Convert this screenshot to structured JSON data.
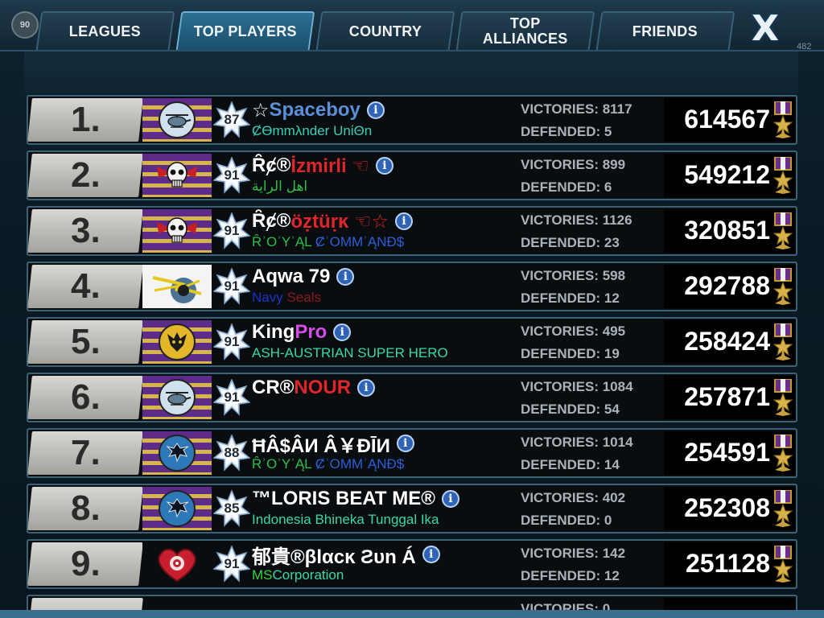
{
  "top_bar": {
    "level_badge": "90",
    "tabs": [
      {
        "label": "LEAGUES",
        "active": false
      },
      {
        "label": "TOP PLAYERS",
        "active": true
      },
      {
        "label": "COUNTRY",
        "active": false
      },
      {
        "label": "TOP\nALLIANCES",
        "active": false
      },
      {
        "label": "FRIENDS",
        "active": false
      }
    ],
    "close_label": "X",
    "corner_text": "482"
  },
  "stat_labels": {
    "victories": "VICTORIES:",
    "defended": "DEFENDED:"
  },
  "players": [
    {
      "rank": "1.",
      "level": "87",
      "emblem": "helicopter-emblem",
      "name_parts": [
        {
          "text": "☆",
          "color": "#ffffff"
        },
        {
          "text": "Spaceboy",
          "color": "#5b8fd8"
        }
      ],
      "alliance_parts": [
        {
          "text": "ȻӨmmλnder UnίΘn",
          "color": "#37d0b6"
        }
      ],
      "victories": "8117",
      "defended": "5",
      "score": "614567"
    },
    {
      "rank": "2.",
      "level": "91",
      "emblem": "skull-emblem",
      "name_parts": [
        {
          "text": "Ȓȼ®",
          "color": "#ffffff"
        },
        {
          "text": "İzmirli ☜",
          "color": "#e0252b"
        }
      ],
      "alliance_parts": [
        {
          "text": "اهل الراية",
          "color": "#2bbf4a"
        }
      ],
      "victories": "899",
      "defended": "6",
      "score": "549212"
    },
    {
      "rank": "3.",
      "level": "91",
      "emblem": "skull-emblem",
      "name_parts": [
        {
          "text": "Ȓȼ®",
          "color": "#ffffff"
        },
        {
          "text": "öẓtüṛĸ ☜☆",
          "color": "#e0252b"
        }
      ],
      "alliance_parts": [
        {
          "text": "ȒʾOʾYʾĄL ",
          "color": "#2bbf4a"
        },
        {
          "text": "ȻʾOMMʾĄNĐ$",
          "color": "#2a5fd6"
        }
      ],
      "victories": "1126",
      "defended": "23",
      "score": "320851"
    },
    {
      "rank": "4.",
      "level": "91",
      "emblem": "lightning-emblem",
      "name_parts": [
        {
          "text": "Aqwa 79",
          "color": "#ffffff"
        }
      ],
      "alliance_parts": [
        {
          "text": "Navy ",
          "color": "#1a33c8"
        },
        {
          "text": "Seals",
          "color": "#8a1a1a"
        }
      ],
      "victories": "598",
      "defended": "12",
      "score": "292788"
    },
    {
      "rank": "5.",
      "level": "91",
      "emblem": "beast-emblem",
      "name_parts": [
        {
          "text": "King ",
          "color": "#ffffff"
        },
        {
          "text": "Pro",
          "color": "#d44dea"
        }
      ],
      "alliance_parts": [
        {
          "text": "ASH-AUSTRIAN SUPER HERO",
          "color": "#39d8a8"
        }
      ],
      "victories": "495",
      "defended": "19",
      "score": "258424"
    },
    {
      "rank": "6.",
      "level": "91",
      "emblem": "helicopter-emblem",
      "name_parts": [
        {
          "text": "CR®",
          "color": "#ffffff"
        },
        {
          "text": "NOUR",
          "color": "#e0252b"
        }
      ],
      "alliance_parts": [],
      "victories": "1084",
      "defended": "54",
      "score": "257871"
    },
    {
      "rank": "7.",
      "level": "88",
      "emblem": "wolf-emblem",
      "name_parts": [
        {
          "text": "ĦÂ$ÂИ Â￥ĐĪИ",
          "color": "#ffffff"
        }
      ],
      "alliance_parts": [
        {
          "text": "ȒʾOʾYʾĄL ",
          "color": "#2bbf4a"
        },
        {
          "text": "ȻʾOMMʾĄNĐ$",
          "color": "#2a5fd6"
        }
      ],
      "victories": "1014",
      "defended": "14",
      "score": "254591"
    },
    {
      "rank": "8.",
      "level": "85",
      "emblem": "wolf-emblem",
      "name_parts": [
        {
          "text": "™LORIS BEAT ME®",
          "color": "#ffffff"
        }
      ],
      "alliance_parts": [
        {
          "text": "Indonesia Bhineka Tunggal Ika",
          "color": "#39d8a8"
        }
      ],
      "victories": "402",
      "defended": "0",
      "score": "252308"
    },
    {
      "rank": "9.",
      "level": "91",
      "emblem": "heart-emblem",
      "name_parts": [
        {
          "text": "郁貴®βlαcĸ Ƨυn Á",
          "color": "#ffffff"
        }
      ],
      "alliance_parts": [
        {
          "text": "MS",
          "color": "#3ad13a"
        },
        {
          "text": "Corporation",
          "color": "#39d8a8"
        }
      ],
      "victories": "142",
      "defended": "12",
      "score": "251128"
    }
  ],
  "partial_row": {
    "victories_label": "VICTORIES: 0"
  }
}
